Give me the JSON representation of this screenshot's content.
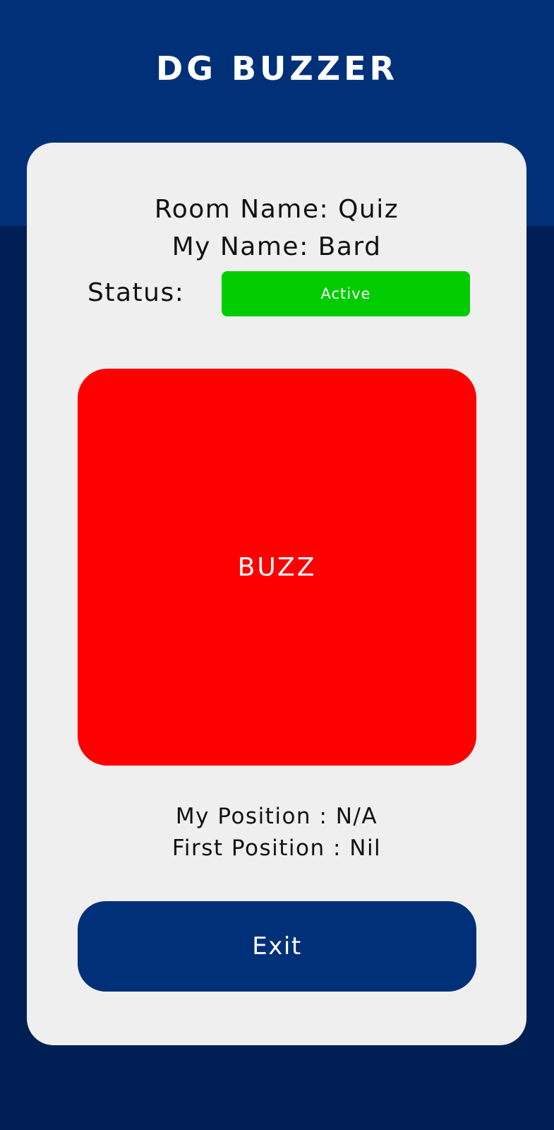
{
  "app": {
    "title": "DG BUZZER"
  },
  "room": {
    "line": "Room Name: Quiz"
  },
  "player": {
    "line": "My Name: Bard"
  },
  "status": {
    "label": "Status:",
    "value": "Active",
    "color": "#00cc00"
  },
  "buzz": {
    "label": "BUZZ",
    "color": "#ff0000"
  },
  "positions": {
    "my_position": "My Position : N/A",
    "first_position": "First Position : Nil"
  },
  "exit": {
    "label": "Exit"
  },
  "theme": {
    "header_color": "#003078",
    "background_color": "#001f55",
    "card_color": "#efefef"
  }
}
